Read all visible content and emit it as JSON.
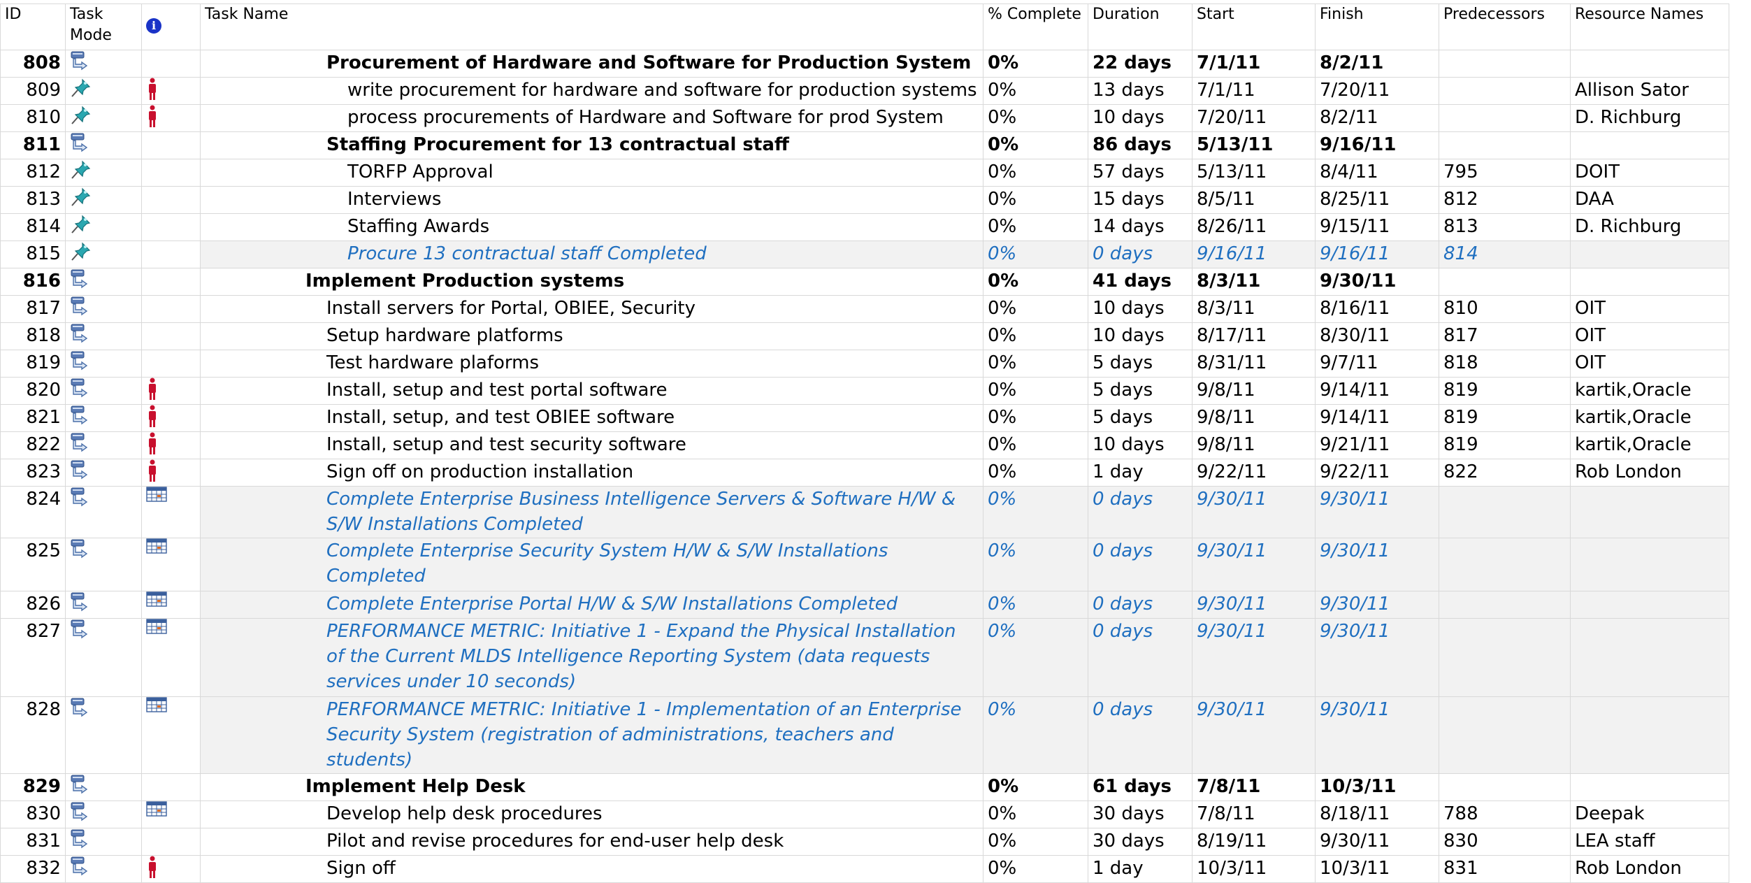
{
  "columns": {
    "id": "ID",
    "task_mode": "Task Mode",
    "info": "i",
    "task_name": "Task Name",
    "pct": "% Complete",
    "duration": "Duration",
    "start": "Start",
    "finish": "Finish",
    "predecessors": "Predecessors",
    "resources": "Resource Names"
  },
  "rows": [
    {
      "id": "808",
      "mode": "auto",
      "ind": "",
      "level": 1,
      "type": "summary",
      "name": "Procurement of Hardware and Software for Production System",
      "pct": "0%",
      "dur": "22 days",
      "start": "7/1/11",
      "finish": "8/2/11",
      "pred": "",
      "res": ""
    },
    {
      "id": "809",
      "mode": "manual",
      "ind": "person",
      "level": 2,
      "type": "task",
      "name": "write procurement for hardware and software for production systems",
      "pct": "0%",
      "dur": "13 days",
      "start": "7/1/11",
      "finish": "7/20/11",
      "pred": "",
      "res": "Allison Sator"
    },
    {
      "id": "810",
      "mode": "manual",
      "ind": "person",
      "level": 2,
      "type": "task",
      "name": "process procurements of Hardware and Software for prod System",
      "pct": "0%",
      "dur": "10 days",
      "start": "7/20/11",
      "finish": "8/2/11",
      "pred": "",
      "res": "D. Richburg"
    },
    {
      "id": "811",
      "mode": "auto",
      "ind": "",
      "level": 1,
      "type": "summary",
      "name": "Staffing Procurement for 13 contractual staff",
      "pct": "0%",
      "dur": "86 days",
      "start": "5/13/11",
      "finish": "9/16/11",
      "pred": "",
      "res": ""
    },
    {
      "id": "812",
      "mode": "manual",
      "ind": "",
      "level": 2,
      "type": "task",
      "name": "TORFP Approval",
      "pct": "0%",
      "dur": "57 days",
      "start": "5/13/11",
      "finish": "8/4/11",
      "pred": "795",
      "res": "DOIT"
    },
    {
      "id": "813",
      "mode": "manual",
      "ind": "",
      "level": 2,
      "type": "task",
      "name": "Interviews",
      "pct": "0%",
      "dur": "15 days",
      "start": "8/5/11",
      "finish": "8/25/11",
      "pred": "812",
      "res": "DAA"
    },
    {
      "id": "814",
      "mode": "manual",
      "ind": "",
      "level": 2,
      "type": "task",
      "name": "Staffing Awards",
      "pct": "0%",
      "dur": "14 days",
      "start": "8/26/11",
      "finish": "9/15/11",
      "pred": "813",
      "res": "D. Richburg"
    },
    {
      "id": "815",
      "mode": "manual",
      "ind": "",
      "level": 2,
      "type": "milestone",
      "name": "Procure 13 contractual staff Completed",
      "pct": "0%",
      "dur": "0 days",
      "start": "9/16/11",
      "finish": "9/16/11",
      "pred": "814",
      "res": ""
    },
    {
      "id": "816",
      "mode": "auto",
      "ind": "",
      "level": 0,
      "type": "summary",
      "name": "Implement Production systems",
      "pct": "0%",
      "dur": "41 days",
      "start": "8/3/11",
      "finish": "9/30/11",
      "pred": "",
      "res": ""
    },
    {
      "id": "817",
      "mode": "auto",
      "ind": "",
      "level": 1,
      "type": "task",
      "name": "Install servers for Portal, OBIEE, Security",
      "pct": "0%",
      "dur": "10 days",
      "start": "8/3/11",
      "finish": "8/16/11",
      "pred": "810",
      "res": "OIT"
    },
    {
      "id": "818",
      "mode": "auto",
      "ind": "",
      "level": 1,
      "type": "task",
      "name": "Setup hardware platforms",
      "pct": "0%",
      "dur": "10 days",
      "start": "8/17/11",
      "finish": "8/30/11",
      "pred": "817",
      "res": "OIT"
    },
    {
      "id": "819",
      "mode": "auto",
      "ind": "",
      "level": 1,
      "type": "task",
      "name": "Test hardware plaforms",
      "pct": "0%",
      "dur": "5 days",
      "start": "8/31/11",
      "finish": "9/7/11",
      "pred": "818",
      "res": "OIT"
    },
    {
      "id": "820",
      "mode": "auto",
      "ind": "person",
      "level": 1,
      "type": "task",
      "name": "Install, setup and test portal software",
      "pct": "0%",
      "dur": "5 days",
      "start": "9/8/11",
      "finish": "9/14/11",
      "pred": "819",
      "res": "kartik,Oracle"
    },
    {
      "id": "821",
      "mode": "auto",
      "ind": "person",
      "level": 1,
      "type": "task",
      "name": "Install, setup, and test OBIEE software",
      "pct": "0%",
      "dur": "5 days",
      "start": "9/8/11",
      "finish": "9/14/11",
      "pred": "819",
      "res": "kartik,Oracle"
    },
    {
      "id": "822",
      "mode": "auto",
      "ind": "person",
      "level": 1,
      "type": "task",
      "name": "Install, setup and test security software",
      "pct": "0%",
      "dur": "10 days",
      "start": "9/8/11",
      "finish": "9/21/11",
      "pred": "819",
      "res": "kartik,Oracle"
    },
    {
      "id": "823",
      "mode": "auto",
      "ind": "person",
      "level": 1,
      "type": "task",
      "name": "Sign off on production installation",
      "pct": "0%",
      "dur": "1 day",
      "start": "9/22/11",
      "finish": "9/22/11",
      "pred": "822",
      "res": "Rob London"
    },
    {
      "id": "824",
      "mode": "auto",
      "ind": "table",
      "level": 1,
      "type": "milestone",
      "name": "Complete Enterprise Business Intelligence Servers & Software  H/W & S/W Installations Completed",
      "pct": "0%",
      "dur": "0 days",
      "start": "9/30/11",
      "finish": "9/30/11",
      "pred": "",
      "res": ""
    },
    {
      "id": "825",
      "mode": "auto",
      "ind": "table",
      "level": 1,
      "type": "milestone",
      "name": "Complete Enterprise Security System H/W & S/W Installations Completed",
      "pct": "0%",
      "dur": "0 days",
      "start": "9/30/11",
      "finish": "9/30/11",
      "pred": "",
      "res": ""
    },
    {
      "id": "826",
      "mode": "auto",
      "ind": "table",
      "level": 1,
      "type": "milestone",
      "name": "Complete Enterprise Portal H/W & S/W Installations Completed",
      "pct": "0%",
      "dur": "0 days",
      "start": "9/30/11",
      "finish": "9/30/11",
      "pred": "",
      "res": ""
    },
    {
      "id": "827",
      "mode": "auto",
      "ind": "table",
      "level": 1,
      "type": "milestone",
      "name": "PERFORMANCE METRIC: Initiative 1 - Expand the Physical Installation of the Current MLDS Intelligence Reporting System (data requests services under 10 seconds)",
      "pct": "0%",
      "dur": "0 days",
      "start": "9/30/11",
      "finish": "9/30/11",
      "pred": "",
      "res": ""
    },
    {
      "id": "828",
      "mode": "auto",
      "ind": "table",
      "level": 1,
      "type": "milestone",
      "name": "PERFORMANCE METRIC: Initiative 1 - Implementation of an Enterprise Security System (registration of administrations, teachers and students)",
      "pct": "0%",
      "dur": "0 days",
      "start": "9/30/11",
      "finish": "9/30/11",
      "pred": "",
      "res": ""
    },
    {
      "id": "829",
      "mode": "auto",
      "ind": "",
      "level": 0,
      "type": "summary",
      "name": "Implement Help Desk",
      "pct": "0%",
      "dur": "61 days",
      "start": "7/8/11",
      "finish": "10/3/11",
      "pred": "",
      "res": ""
    },
    {
      "id": "830",
      "mode": "auto",
      "ind": "table",
      "level": 1,
      "type": "task",
      "name": "Develop help desk procedures",
      "pct": "0%",
      "dur": "30 days",
      "start": "7/8/11",
      "finish": "8/18/11",
      "pred": "788",
      "res": "Deepak"
    },
    {
      "id": "831",
      "mode": "auto",
      "ind": "",
      "level": 1,
      "type": "task",
      "name": "Pilot and revise procedures for end-user help desk",
      "pct": "0%",
      "dur": "30 days",
      "start": "8/19/11",
      "finish": "9/30/11",
      "pred": "830",
      "res": "LEA staff"
    },
    {
      "id": "832",
      "mode": "auto",
      "ind": "person",
      "level": 1,
      "type": "task",
      "name": "Sign off",
      "pct": "0%",
      "dur": "1 day",
      "start": "10/3/11",
      "finish": "10/3/11",
      "pred": "831",
      "res": "Rob London"
    }
  ]
}
